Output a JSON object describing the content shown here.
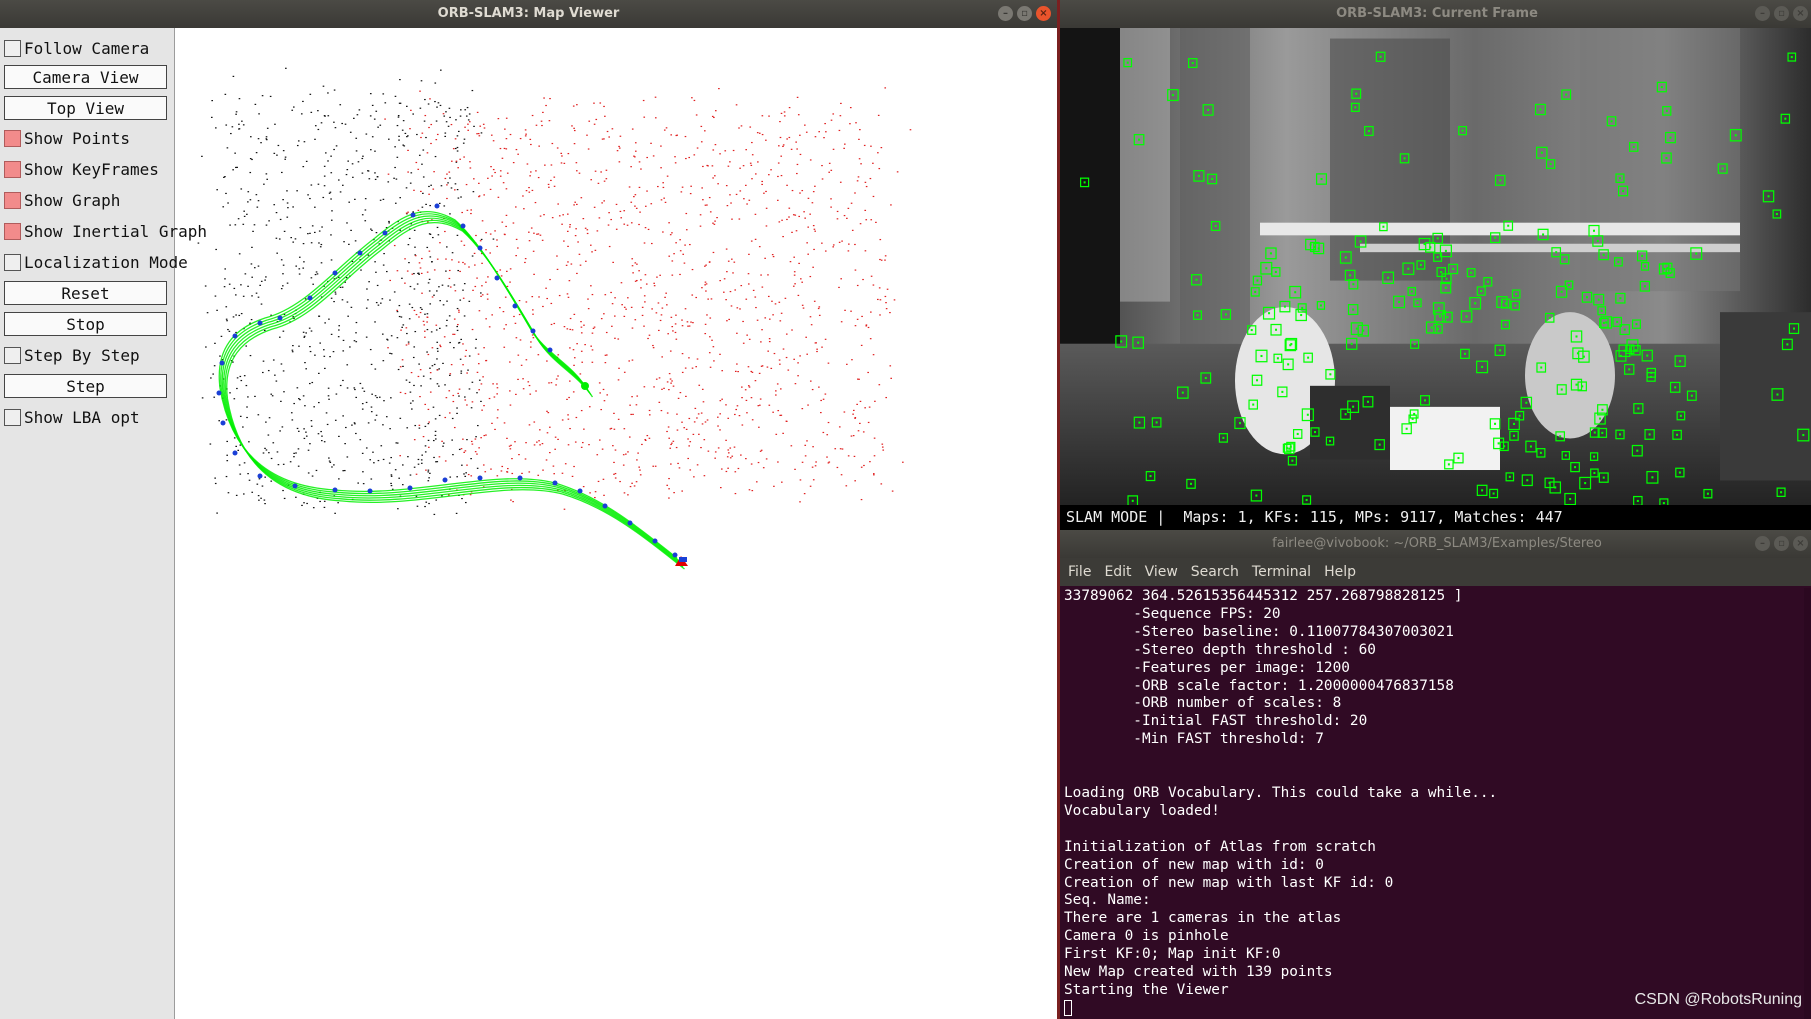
{
  "map_viewer": {
    "title": "ORB-SLAM3: Map Viewer",
    "panel": {
      "follow_camera": {
        "label": "Follow Camera",
        "checked": false
      },
      "camera_view": "Camera View",
      "top_view": "Top View",
      "show_points": {
        "label": "Show Points",
        "checked": true
      },
      "show_keyframes": {
        "label": "Show KeyFrames",
        "checked": true
      },
      "show_graph": {
        "label": "Show Graph",
        "checked": true
      },
      "show_inertial_graph": {
        "label": "Show Inertial Graph",
        "checked": true
      },
      "localization_mode": {
        "label": "Localization Mode",
        "checked": false
      },
      "reset": "Reset",
      "stop": "Stop",
      "step_by_step": {
        "label": "Step By Step",
        "checked": false
      },
      "step": "Step",
      "show_lba_opt": {
        "label": "Show LBA opt",
        "checked": false
      }
    },
    "colors": {
      "map_points_black": "#111111",
      "map_points_red": "#e02020",
      "trajectory": "#00ee00",
      "keyframes": "#1a3fd6",
      "current_camera": "#e00000"
    }
  },
  "current_frame": {
    "title": "ORB-SLAM3: Current Frame",
    "status": "SLAM MODE |  Maps: 1, KFs: 115, MPs: 9117, Matches: 447",
    "feature_color": "#00ff00"
  },
  "terminal": {
    "title": "fairlee@vivobook: ~/ORB_SLAM3/Examples/Stereo",
    "menu": [
      "File",
      "Edit",
      "View",
      "Search",
      "Terminal",
      "Help"
    ],
    "lines": [
      "33789062 364.52615356445312 257.268798828125 ]",
      "        -Sequence FPS: 20",
      "        -Stereo baseline: 0.11007784307003021",
      "        -Stereo depth threshold : 60",
      "        -Features per image: 1200",
      "        -ORB scale factor: 1.2000000476837158",
      "        -ORB number of scales: 8",
      "        -Initial FAST threshold: 20",
      "        -Min FAST threshold: 7",
      "",
      "",
      "Loading ORB Vocabulary. This could take a while...",
      "Vocabulary loaded!",
      "",
      "Initialization of Atlas from scratch",
      "Creation of new map with id: 0",
      "Creation of new map with last KF id: 0",
      "Seq. Name:",
      "There are 1 cameras in the atlas",
      "Camera 0 is pinhole",
      "First KF:0; Map init KF:0",
      "New Map created with 139 points",
      "Starting the Viewer"
    ],
    "background": "#300a24"
  },
  "watermark": "CSDN @RobotsRuning"
}
